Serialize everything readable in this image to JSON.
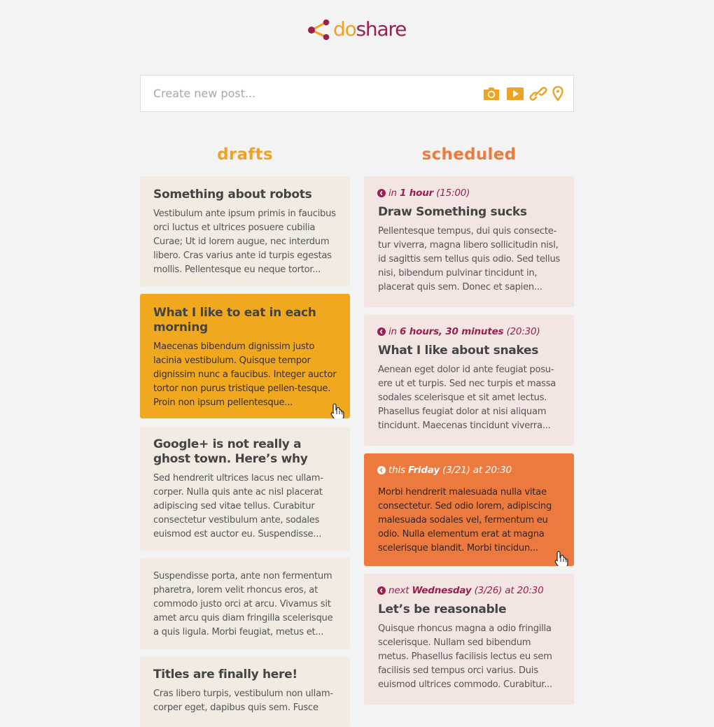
{
  "logo": {
    "part1": "do",
    "part2": "share"
  },
  "composer": {
    "placeholder": "Create new post...",
    "tools": [
      "camera-icon",
      "video-icon",
      "link-icon",
      "location-pin-icon"
    ]
  },
  "colors": {
    "brand_orange": "#eea327",
    "brand_purple": "#9c1f52",
    "scheduled_orange": "#ec7b3f",
    "draft_card": "#f1ebe1",
    "scheduled_card": "#f3e5e2"
  },
  "drafts": {
    "title": "drafts",
    "items": [
      {
        "title": "Something about robots",
        "body": "Vestibulum ante ipsum primis in faucibus orci luctus et ultrices posuere cubilia Curae; Ut id lorem augue, nec interdum libero. Cras varius ante id turpis egestas mollis. Pellentesque eu neque tortor..."
      },
      {
        "title": "What I like to eat in each morning",
        "body": "Maecenas bibendum dignissim justo lacinia vestibulum. Quisque tempor dignissim nunc a faucibus. Integer auctor tortor non purus tristique pellen-tesque. Proin non ipsum pellentesque..."
      },
      {
        "title": "Google+ is not really a ghost town. Here’s why",
        "body": "Sed hendrerit ultrices lacus nec ullam-corper. Nulla quis ante ac nisl placerat adipiscing sed vitae tellus. Curabitur consectetur vestibulum ante, sodales euismod est auctor eu. Suspendisse..."
      },
      {
        "title": "",
        "body": "Suspendisse porta, ante non fermentum pharetra, lorem velit rhoncus eros, at commodo justo orci at arcu. Vivamus sit amet arcu quis diam fringilla scelerisque a quis ligula. Morbi feugiat, metus et..."
      },
      {
        "title": "Titles are finally here!",
        "body": "Cras libero turpis, vestibulum non ullam-corper eget, dapibus quis sem. Fusce"
      }
    ]
  },
  "scheduled": {
    "title": "scheduled",
    "items": [
      {
        "when_prefix": "in",
        "when_bold": "1 hour",
        "when_suffix": "(15:00)",
        "title": "Draw Something sucks",
        "body": "Pellentesque tempus, dui quis consecte-tur viverra, magna libero sollicitudin nisl, id sagittis sem tellus quis odio. Sed tellus nisi, bibendum pulvinar tincidunt in, placerat quis sem. Donec et sapien..."
      },
      {
        "when_prefix": "in",
        "when_bold": "6 hours, 30 minutes",
        "when_suffix": "(20:30)",
        "title": "What I like about snakes",
        "body": "Aenean eget dolor id ante feugiat posu-ere ut et turpis. Sed nec turpis et massa sodales scelerisque et sit amet lectus. Phasellus feugiat dolor at nisi aliquam tincidunt. Maecenas tincidunt viverra..."
      },
      {
        "when_prefix": "this",
        "when_bold": "Friday",
        "when_suffix": "(3/21) at 20:30",
        "title": "",
        "body": "Morbi hendrerit malesuada nulla vitae consectetur. Sed odio lorem, adipiscing malesuada sodales vel, fermentum eu odio. Nulla elementum erat at magna scelerisque blandit. Morbi tincidun..."
      },
      {
        "when_prefix": "next",
        "when_bold": "Wednesday",
        "when_suffix": "(3/26) at 20:30",
        "title": "Let’s be reasonable",
        "body": "Quisque rhoncus magna a odio fringilla scelerisque. Nullam sed bibendum metus. Phasellus facilisis lectus eu sem facilisis sed tempus orci varius. Duis euismod ultrices commodo. Curabitur..."
      }
    ]
  }
}
